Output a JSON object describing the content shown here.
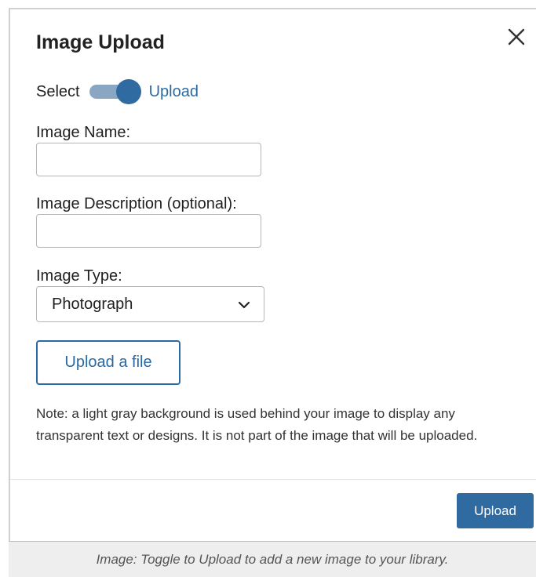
{
  "dialog": {
    "title": "Image Upload",
    "close_icon": "close-icon",
    "toggle": {
      "left_label": "Select",
      "right_label": "Upload",
      "state": "upload",
      "track_color": "#89a7c3",
      "knob_color": "#2f6aa0"
    },
    "fields": {
      "name_label": "Image Name:",
      "name_value": "",
      "description_label": "Image Description (optional):",
      "description_value": "",
      "type_label": "Image Type:",
      "type_value": "Photograph",
      "type_icon": "chevron-down-icon"
    },
    "upload_file_label": "Upload a file",
    "note": "Note: a light gray background is used behind your image to display any transparent text or designs. It is not part of the image that will be uploaded.",
    "upload_button_label": "Upload",
    "accent_color": "#2a6aa3"
  },
  "caption": "Image: Toggle to Upload to add a new image to your library."
}
